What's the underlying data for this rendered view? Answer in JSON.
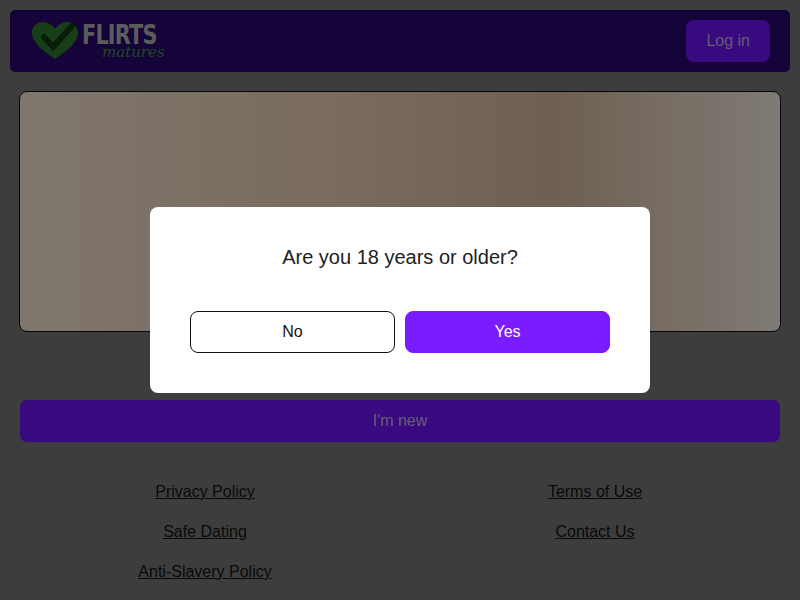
{
  "header": {
    "logo": {
      "name": "FLIRTS",
      "tagline": "matures"
    },
    "login_button": "Log in"
  },
  "hero": {
    "photo": true
  },
  "new_button": "I'm new",
  "footer": {
    "links": [
      "Privacy Policy",
      "Terms of Use",
      "Safe Dating",
      "Contact Us",
      "Anti-Slavery Policy"
    ]
  },
  "modal": {
    "question": "Are you 18 years or older?",
    "buttons": [
      {
        "label": "No",
        "kind": "secondary"
      },
      {
        "label": "Yes",
        "kind": "primary"
      }
    ]
  }
}
